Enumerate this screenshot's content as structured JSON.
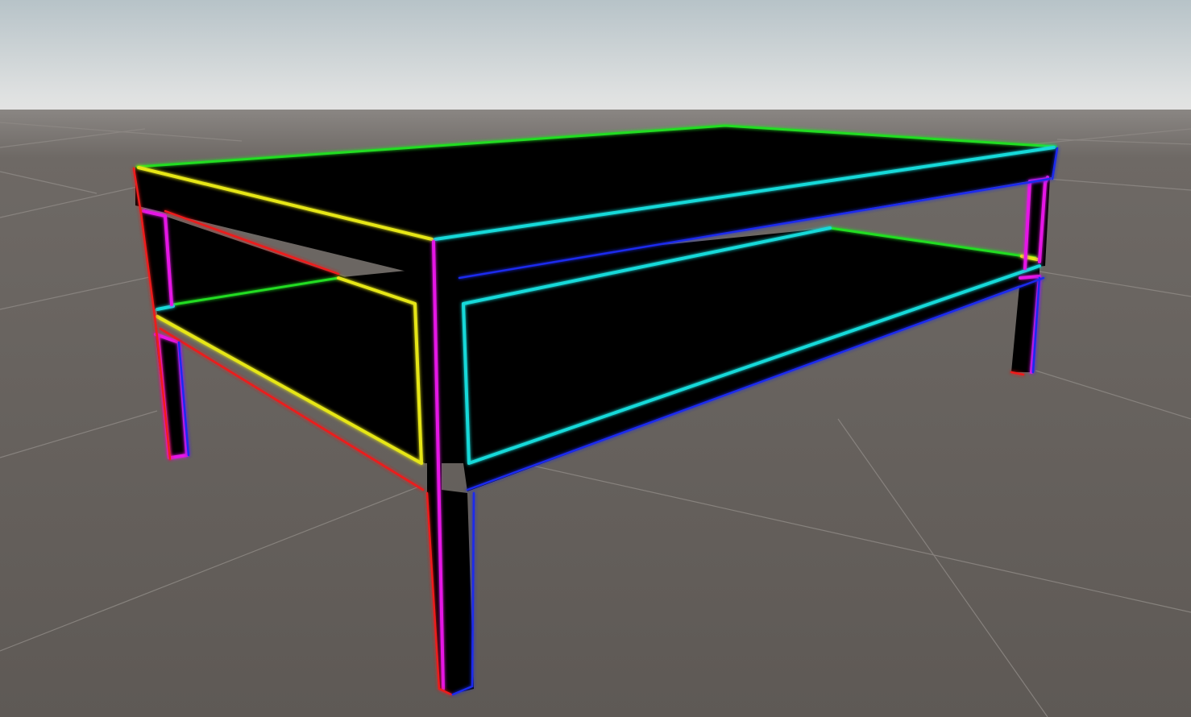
{
  "scene": {
    "subject": "table",
    "colors": {
      "sky_top": "#b8c4c9",
      "sky_bottom": "#e0e2e2",
      "ground": "#605b57",
      "grid_line": "#8a8580",
      "solid": "#000000",
      "edge_green": "#22dd22",
      "edge_yellow": "#e6e619",
      "edge_cyan": "#19d9d9",
      "edge_magenta": "#e619e6",
      "edge_red": "#ee1a1a",
      "edge_blue": "#1a2bee"
    }
  }
}
